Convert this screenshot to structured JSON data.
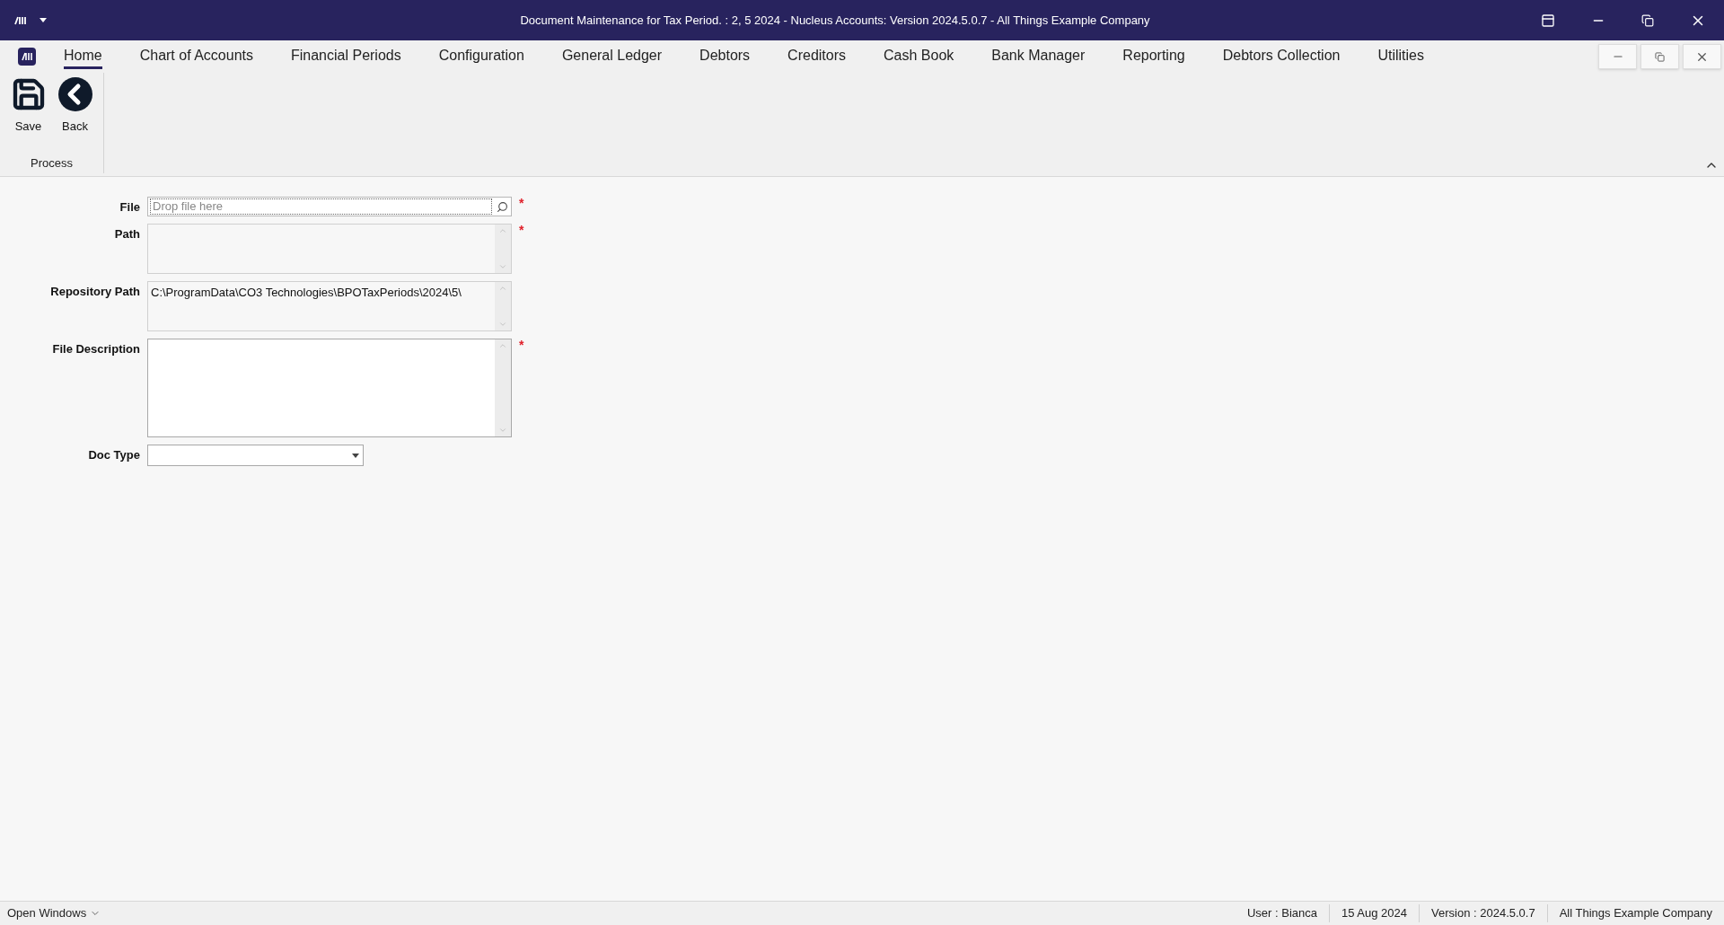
{
  "window": {
    "title": "Document Maintenance for Tax Period. : 2, 5 2024 - Nucleus Accounts: Version 2024.5.0.7 - All Things Example Company"
  },
  "tabs": [
    {
      "label": "Home",
      "selected": true
    },
    {
      "label": "Chart of Accounts",
      "selected": false
    },
    {
      "label": "Financial Periods",
      "selected": false
    },
    {
      "label": "Configuration",
      "selected": false
    },
    {
      "label": "General Ledger",
      "selected": false
    },
    {
      "label": "Debtors",
      "selected": false
    },
    {
      "label": "Creditors",
      "selected": false
    },
    {
      "label": "Cash Book",
      "selected": false
    },
    {
      "label": "Bank Manager",
      "selected": false
    },
    {
      "label": "Reporting",
      "selected": false
    },
    {
      "label": "Debtors Collection",
      "selected": false
    },
    {
      "label": "Utilities",
      "selected": false
    }
  ],
  "ribbon": {
    "buttons": [
      {
        "kind": "save",
        "label": "Save"
      },
      {
        "kind": "back",
        "label": "Back"
      }
    ],
    "group": "Process"
  },
  "form": [
    {
      "kind": "search",
      "label": "File",
      "placeholder": "Drop file here",
      "required_mark": "*"
    },
    {
      "kind": "memo",
      "label": "Path",
      "required_mark": "*",
      "disabled": true
    },
    {
      "kind": "memo",
      "label": "Repository Path",
      "value": "C:\\ProgramData\\CO3 Technologies\\BPOTaxPeriods\\2024\\5\\",
      "disabled": true
    },
    {
      "kind": "memo_tall",
      "label": "File Description",
      "required_mark": "*",
      "disabled": false
    },
    {
      "kind": "dropdown",
      "label": "Doc Type"
    }
  ],
  "status_bar": {
    "open_windows": "Open Windows",
    "items": [
      "User : Bianca",
      "15 Aug 2024",
      "Version : 2024.5.0.7",
      "All Things Example Company"
    ]
  }
}
